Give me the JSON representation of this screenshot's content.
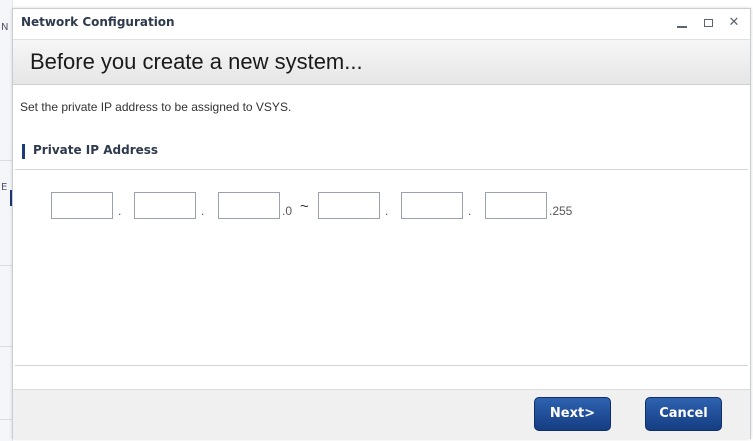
{
  "window": {
    "title": "Network Configuration",
    "controls": {
      "minimize_icon": "minimize-icon",
      "maximize_icon": "maximize-icon",
      "close_icon": "close-icon"
    }
  },
  "header": {
    "heading": "Before you create a new system..."
  },
  "main": {
    "instruction": "Set the private IP address to be assigned to VSYS.",
    "section_title": "Private IP Address",
    "ip_range": {
      "start_fields": [
        "",
        "",
        ""
      ],
      "start_suffix": ".0",
      "range_separator": "~",
      "end_fields": [
        "",
        "",
        ""
      ],
      "end_suffix": ".255",
      "dot": "."
    }
  },
  "footer": {
    "next_label": "Next>",
    "cancel_label": "Cancel"
  },
  "colors": {
    "accent": "#1b3a7a",
    "button": "#1f4c96"
  },
  "background": {
    "left_strip_fragments": [
      "N",
      "E"
    ]
  }
}
